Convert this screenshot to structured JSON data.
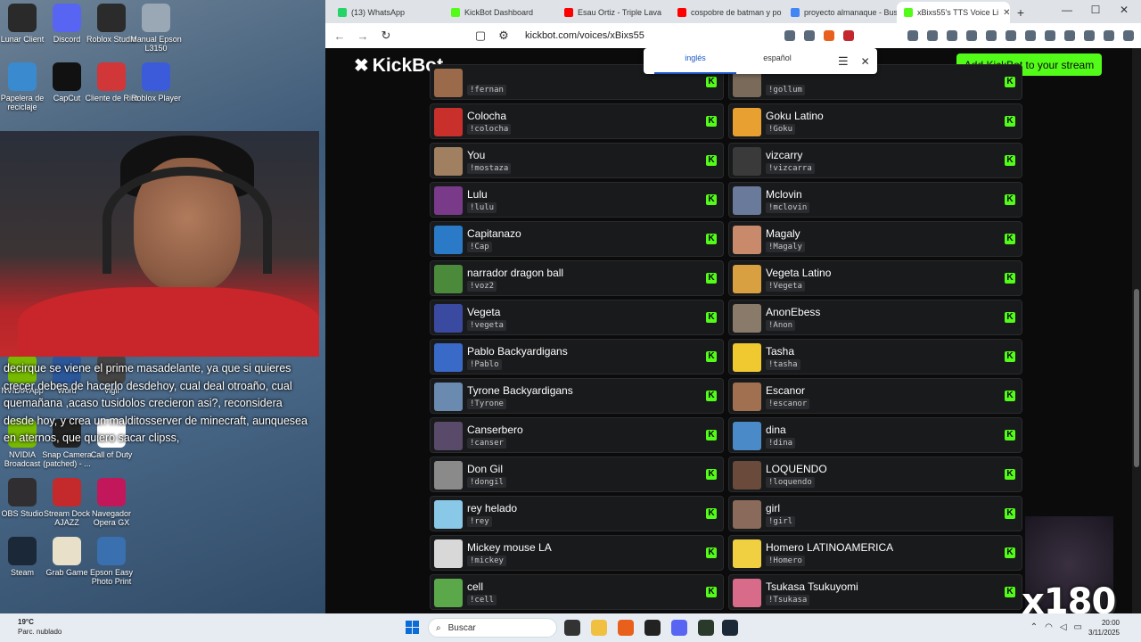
{
  "desktop": {
    "icons": [
      {
        "label": "Lunar Client",
        "icon": "lunar-icon",
        "color": "#2a2a2a"
      },
      {
        "label": "Discord",
        "icon": "discord-icon",
        "color": "#5865f2"
      },
      {
        "label": "Roblox Studio",
        "icon": "roblox-studio-icon",
        "color": "#2b2b2b"
      },
      {
        "label": "Manual Epson L3150",
        "icon": "epson-manual-icon",
        "color": "#9aa7b4"
      },
      {
        "label": "Papelera de reciclaje",
        "icon": "recycle-bin-icon",
        "color": "#3a8ad0"
      },
      {
        "label": "CapCut",
        "icon": "capcut-icon",
        "color": "#111111"
      },
      {
        "label": "Cliente de Riot",
        "icon": "riot-icon",
        "color": "#d13639"
      },
      {
        "label": "Roblox Player",
        "icon": "roblox-player-icon",
        "color": "#3b5bdb"
      },
      {
        "label": "NVIDIA App",
        "icon": "nvidia-app-icon",
        "color": "#76b900"
      },
      {
        "label": "Word",
        "icon": "word-icon",
        "color": "#2b579a"
      },
      {
        "label": "Vigil",
        "icon": "vigil-icon",
        "color": "#444444"
      },
      {
        "label": "NVIDIA Broadcast",
        "icon": "nvidia-broadcast-icon",
        "color": "#76b900"
      },
      {
        "label": "Snap Camera (patched) - ...",
        "icon": "snap-camera-icon",
        "color": "#222222"
      },
      {
        "label": "Call of Duty",
        "icon": "call-of-duty-icon",
        "color": "#ffffff"
      },
      {
        "label": "OBS Studio",
        "icon": "obs-icon",
        "color": "#302e31"
      },
      {
        "label": "Stream Dock AJAZZ",
        "icon": "stream-dock-icon",
        "color": "#c42a2c"
      },
      {
        "label": "Navegador Opera GX",
        "icon": "opera-gx-icon",
        "color": "#c2185b"
      },
      {
        "label": "Steam",
        "icon": "steam-icon",
        "color": "#1b2838"
      },
      {
        "label": "Grab Game",
        "icon": "crab-game-icon",
        "color": "#e8e0c8"
      },
      {
        "label": "Epson Easy Photo Print",
        "icon": "epson-photo-icon",
        "color": "#3a6fb0"
      }
    ]
  },
  "captions": "decirque se viene el prime masadelante, ya que si quieres crecer debes de hacerlo desdehoy, cual deal otroaño, cual quemañana ,acaso tusidolos crecieron asi?, reconsidera desde hoy, y crea un malditosserver de minecraft, aunquesea en aternos, que quiero sacar clipss,",
  "browser": {
    "tabs": [
      {
        "title": "(13) WhatsApp",
        "color": "#25d366",
        "active": false
      },
      {
        "title": "KickBot Dashboard",
        "color": "#53fc18",
        "active": false
      },
      {
        "title": "Esau Ortiz - Triple Lava",
        "color": "#ff0000",
        "active": false
      },
      {
        "title": "cospobre de batman y po",
        "color": "#ff0000",
        "active": false
      },
      {
        "title": "proyecto almanaque - Bus",
        "color": "#4285f4",
        "active": false
      },
      {
        "title": "xBixs55's TTS Voice Li",
        "color": "#53fc18",
        "active": true
      }
    ],
    "url": "kickbot.com/voices/xBixs55",
    "window_controls": [
      "—",
      "☐",
      "✕"
    ]
  },
  "translate_bar": {
    "languages": [
      "inglés",
      "español"
    ],
    "selected": "inglés"
  },
  "kickbot": {
    "logo": "KickBot",
    "add_button": "Add KickBot to your stream",
    "accent": "#53fc18"
  },
  "voices_left": [
    {
      "name": "",
      "cmd": "!fernan",
      "color": "#9a6a4a"
    },
    {
      "name": "Colocha",
      "cmd": "!colocha",
      "color": "#c9302c"
    },
    {
      "name": "You",
      "cmd": "!mostaza",
      "color": "#a08060"
    },
    {
      "name": "Lulu",
      "cmd": "!lulu",
      "color": "#7a3a8a"
    },
    {
      "name": "Capitanazo",
      "cmd": "!Cap",
      "color": "#2a7ac8"
    },
    {
      "name": "narrador dragon ball",
      "cmd": "!voz2",
      "color": "#4a8a3a"
    },
    {
      "name": "Vegeta",
      "cmd": "!vegeta",
      "color": "#3a4aa0"
    },
    {
      "name": "Pablo Backyardigans",
      "cmd": "!Pablo",
      "color": "#3a6ac8"
    },
    {
      "name": "Tyrone Backyardigans",
      "cmd": "!Tyrone",
      "color": "#6a8ab0"
    },
    {
      "name": "Canserbero",
      "cmd": "!canser",
      "color": "#5a4a6a"
    },
    {
      "name": "Don Gil",
      "cmd": "!dongil",
      "color": "#8a8a8a"
    },
    {
      "name": "rey helado",
      "cmd": "!rey",
      "color": "#8ac8e8"
    },
    {
      "name": "Mickey mouse LA",
      "cmd": "!mickey",
      "color": "#d8d8d8"
    },
    {
      "name": "cell",
      "cmd": "!cell",
      "color": "#5aa84a"
    }
  ],
  "voices_right": [
    {
      "name": "",
      "cmd": "!gollum",
      "color": "#7a6a5a"
    },
    {
      "name": "Goku Latino",
      "cmd": "!Goku",
      "color": "#e8a030"
    },
    {
      "name": "vizcarry",
      "cmd": "!vizcarra",
      "color": "#3a3a3a"
    },
    {
      "name": "Mclovin",
      "cmd": "!mclovin",
      "color": "#6a7a9a"
    },
    {
      "name": "Magaly",
      "cmd": "!Magaly",
      "color": "#c88a6a"
    },
    {
      "name": "Vegeta Latino",
      "cmd": "!Vegeta",
      "color": "#d8a040"
    },
    {
      "name": "AnonEbess",
      "cmd": "!Anon",
      "color": "#8a7a6a"
    },
    {
      "name": "Tasha",
      "cmd": "!tasha",
      "color": "#f0c830"
    },
    {
      "name": "Escanor",
      "cmd": "!escanor",
      "color": "#a07050"
    },
    {
      "name": "dina",
      "cmd": "!dina",
      "color": "#4a8ac8"
    },
    {
      "name": "LOQUENDO",
      "cmd": "!loquendo",
      "color": "#6a4a3a"
    },
    {
      "name": "girl",
      "cmd": "!girl",
      "color": "#8a6a5a"
    },
    {
      "name": "Homero LATINOAMERICA",
      "cmd": "!Homero",
      "color": "#f0d040"
    },
    {
      "name": "Tsukasa Tsukuyomi",
      "cmd": "!Tsukasa",
      "color": "#d86a8a"
    }
  ],
  "overlay_text": "x180",
  "taskbar": {
    "temp": "19°C",
    "weather": "Parc. nublado",
    "search_placeholder": "Buscar",
    "time": "20:00",
    "date": "3/11/2025"
  }
}
